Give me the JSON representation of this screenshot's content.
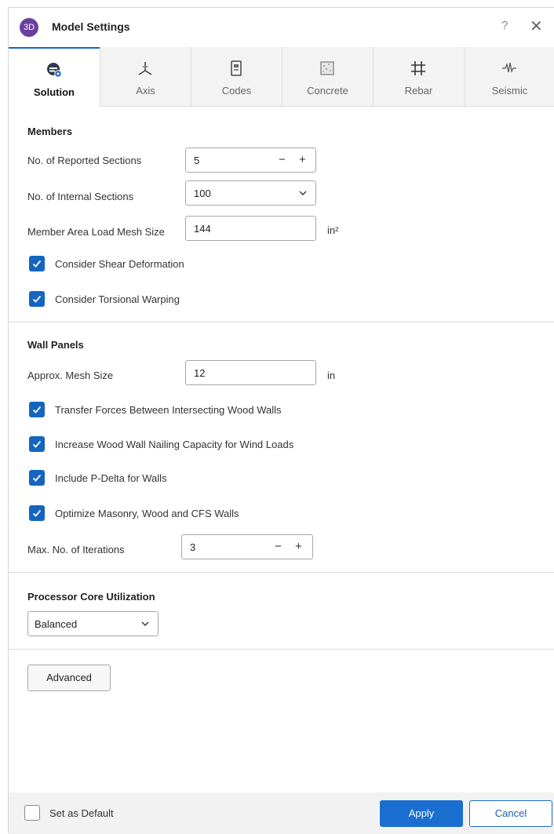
{
  "window": {
    "app_icon_text": "3D",
    "title": "Model Settings",
    "help": "?",
    "close": "✕"
  },
  "tabs": [
    {
      "label": "Solution",
      "icon": "solution-gear-icon",
      "active": true
    },
    {
      "label": "Axis",
      "icon": "axis-icon",
      "active": false
    },
    {
      "label": "Codes",
      "icon": "codes-book-icon",
      "active": false
    },
    {
      "label": "Concrete",
      "icon": "concrete-icon",
      "active": false
    },
    {
      "label": "Rebar",
      "icon": "rebar-grid-icon",
      "active": false
    },
    {
      "label": "Seismic",
      "icon": "seismic-wave-icon",
      "active": false
    }
  ],
  "members": {
    "title": "Members",
    "reported_sections": {
      "label": "No. of Reported Sections",
      "value": "5"
    },
    "internal_sections": {
      "label": "No. of Internal Sections",
      "value": "100"
    },
    "mesh_size": {
      "label": "Member Area Load Mesh Size",
      "value": "144",
      "unit": "in²"
    },
    "shear_deformation": {
      "label": "Consider Shear Deformation",
      "checked": true
    },
    "torsional_warping": {
      "label": "Consider Torsional Warping",
      "checked": true
    }
  },
  "wall_panels": {
    "title": "Wall Panels",
    "mesh_size": {
      "label": "Approx. Mesh Size",
      "value": "12",
      "unit": "in"
    },
    "transfer_forces": {
      "label": "Transfer Forces Between Intersecting Wood Walls",
      "checked": true
    },
    "nailing_capacity": {
      "label": "Increase Wood Wall Nailing Capacity for Wind Loads",
      "checked": true
    },
    "p_delta": {
      "label": "Include P-Delta for Walls",
      "checked": true
    },
    "optimize": {
      "label": "Optimize Masonry, Wood and CFS Walls",
      "checked": true
    },
    "iterations": {
      "label": "Max. No. of Iterations",
      "value": "3"
    }
  },
  "processor": {
    "title": "Processor Core Utilization",
    "value": "Balanced"
  },
  "advanced_label": "Advanced",
  "footer": {
    "set_default": {
      "label": "Set as Default",
      "checked": false
    },
    "apply": "Apply",
    "cancel": "Cancel"
  },
  "colors": {
    "accent": "#1a6ecf",
    "app_icon": "#6b3fa0"
  }
}
